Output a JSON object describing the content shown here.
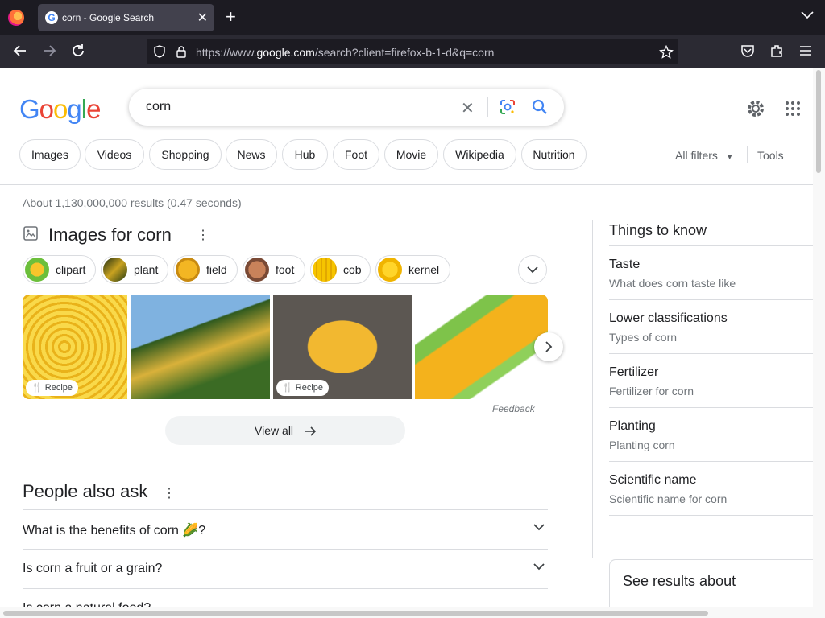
{
  "browser": {
    "tab_title": "corn - Google Search",
    "url_prefix": "https://www.",
    "url_domain": "google.com",
    "url_rest": "/search?client=firefox-b-1-d&q=corn"
  },
  "search": {
    "query": "corn"
  },
  "chips": [
    "Images",
    "Videos",
    "Shopping",
    "News",
    "Hub",
    "Foot",
    "Movie",
    "Wikipedia",
    "Nutrition"
  ],
  "filters": {
    "all_filters": "All filters",
    "tools": "Tools"
  },
  "results_stats": "About 1,130,000,000 results (0.47 seconds)",
  "images_section": {
    "title": "Images for corn",
    "chips": [
      "clipart",
      "plant",
      "field",
      "foot",
      "cob",
      "kernel"
    ],
    "recipe_label": "Recipe",
    "feedback": "Feedback",
    "view_all": "View all"
  },
  "people_also_ask": {
    "title": "People also ask",
    "questions": [
      "What is the benefits of corn 🌽?",
      "Is corn a fruit or a grain?",
      "Is corn a natural food?"
    ]
  },
  "things_to_know": {
    "title": "Things to know",
    "items": [
      {
        "title": "Taste",
        "subtitle": "What does corn taste like"
      },
      {
        "title": "Lower classifications",
        "subtitle": "Types of corn"
      },
      {
        "title": "Fertilizer",
        "subtitle": "Fertilizer for corn"
      },
      {
        "title": "Planting",
        "subtitle": "Planting corn"
      },
      {
        "title": "Scientific name",
        "subtitle": "Scientific name for corn"
      }
    ]
  },
  "see_results_about": "See results about",
  "colors": {
    "google_blue": "#4285f4",
    "google_red": "#ea4335",
    "google_yellow": "#fbbc05",
    "google_green": "#34a853",
    "chrome_dark": "#1c1b22"
  }
}
